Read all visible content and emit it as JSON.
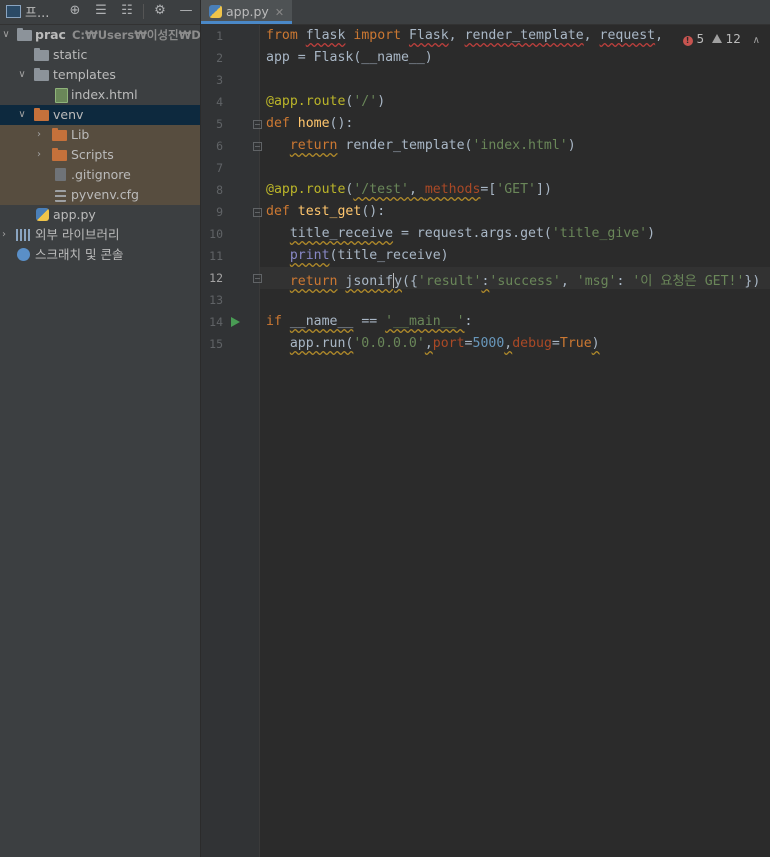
{
  "project_panel": {
    "title": "프..."
  },
  "tree": {
    "root": {
      "name": "prac",
      "path": "C:₩Users₩이성진₩Deskt"
    },
    "static": "static",
    "templates": "templates",
    "index_html": "index.html",
    "venv": "venv",
    "lib": "Lib",
    "scripts": "Scripts",
    "gitignore": ".gitignore",
    "pyvenv": "pyvenv.cfg",
    "app_py": "app.py",
    "external_libs": "외부 라이브러리",
    "scratches": "스크래치 및 콘솔"
  },
  "editor": {
    "tab_label": "app.py",
    "error_count": "5",
    "warning_count": "12",
    "line_numbers": [
      "1",
      "2",
      "3",
      "4",
      "5",
      "6",
      "7",
      "8",
      "9",
      "10",
      "11",
      "12",
      "13",
      "14",
      "15"
    ]
  },
  "code": {
    "l1": {
      "a": "from",
      "b": "flask",
      "c": "import",
      "d": "Flask",
      "e": ", ",
      "f": "render_template",
      "g": ", ",
      "h": "request",
      "i": ","
    },
    "l2": "app = Flask(__name__)",
    "l4": {
      "dec": "@app.route",
      "p1": "(",
      "s": "'/'",
      "p2": ")"
    },
    "l5": {
      "kw": "def",
      "fn": "home",
      "rest": "():"
    },
    "l6": {
      "kw": "return",
      "rest": "render_template(",
      "s": "'index.html'",
      "p": ")"
    },
    "l8": {
      "dec": "@app.route",
      "p1": "(",
      "s": "'/test'",
      "c": ", ",
      "prm": "methods",
      "eq": "=[",
      "s2": "'GET'",
      "p2": "])"
    },
    "l9": {
      "kw": "def",
      "fn": "test_get",
      "rest": "():"
    },
    "l10": {
      "a": "title_receive",
      "b": " = request.args.get(",
      "s": "'title_give'",
      "p": ")"
    },
    "l11": {
      "a": "print",
      "b": "(title_receive)"
    },
    "l12": {
      "kw": "return",
      "a": "jsonif",
      "b": "y",
      "c": "({",
      "s1": "'result'",
      "d": ":",
      "s2": "'success'",
      "e": ", ",
      "s3": "'msg'",
      "f": ": ",
      "s4": "'이 요청은 GET!'",
      "g": "})"
    },
    "l14": {
      "kw": "if",
      "a": "__name__",
      "b": " == ",
      "s": "'__main__'",
      "c": ":"
    },
    "l15": {
      "a": "app.run(",
      "s": "'0.0.0.0'",
      "c1": ",",
      "prm1": "port",
      "eq1": "=",
      "num": "5000",
      "c2": ",",
      "prm2": "debug",
      "eq2": "=",
      "kw": "True",
      "p": ")"
    }
  },
  "icons": [
    "folder-icon",
    "html-file-icon",
    "python-file-icon",
    "gitignore-icon",
    "cfg-file-icon",
    "library-icon",
    "scratches-icon",
    "gear-icon",
    "expand-icon",
    "collapse-icon",
    "minimize-icon",
    "run-icon",
    "error-icon",
    "warning-icon"
  ]
}
